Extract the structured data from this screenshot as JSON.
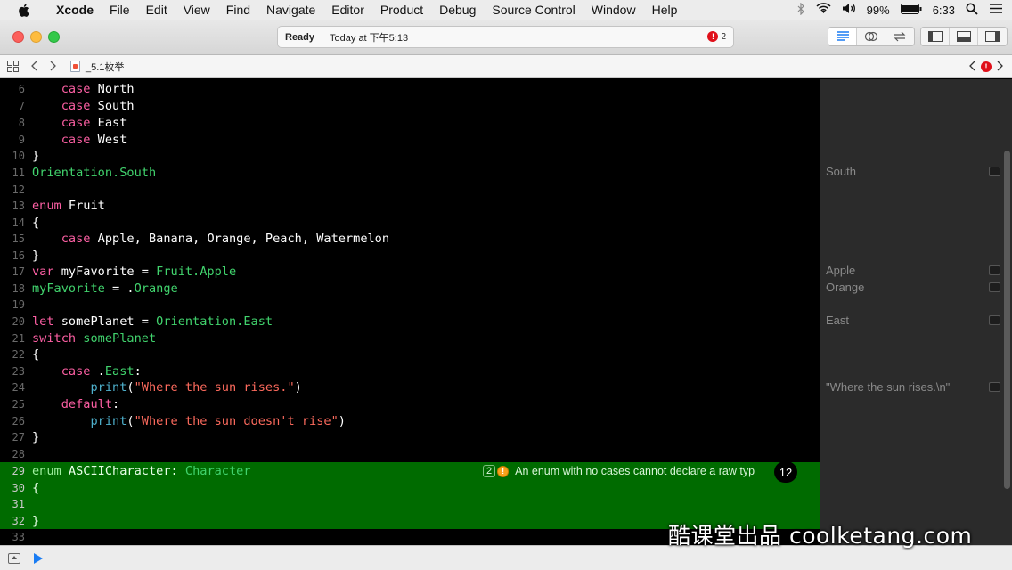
{
  "menubar": {
    "app_name": "Xcode",
    "items": [
      "File",
      "Edit",
      "View",
      "Find",
      "Navigate",
      "Editor",
      "Product",
      "Debug",
      "Source Control",
      "Window",
      "Help"
    ],
    "battery": "99%",
    "time": "6:33"
  },
  "toolbar": {
    "status": "Ready",
    "timestamp": "Today at 下午5:13",
    "error_count": "2"
  },
  "jumpbar": {
    "file_name": "_5.1枚举"
  },
  "editor": {
    "lines": [
      {
        "n": "6"
      },
      {
        "n": "7"
      },
      {
        "n": "8"
      },
      {
        "n": "9"
      },
      {
        "n": "10"
      },
      {
        "n": "11"
      },
      {
        "n": "12"
      },
      {
        "n": "13"
      },
      {
        "n": "14"
      },
      {
        "n": "15"
      },
      {
        "n": "16"
      },
      {
        "n": "17"
      },
      {
        "n": "18"
      },
      {
        "n": "19"
      },
      {
        "n": "20"
      },
      {
        "n": "21"
      },
      {
        "n": "22"
      },
      {
        "n": "23"
      },
      {
        "n": "24"
      },
      {
        "n": "25"
      },
      {
        "n": "26"
      },
      {
        "n": "27"
      },
      {
        "n": "28"
      },
      {
        "n": "29"
      },
      {
        "n": "30"
      },
      {
        "n": "31"
      },
      {
        "n": "32"
      },
      {
        "n": "33"
      }
    ],
    "code": {
      "l6": "case",
      "l6b": " North",
      "l7": "case",
      "l7b": " South",
      "l8": "case",
      "l8b": " East",
      "l9": "case",
      "l9b": " West",
      "l10": "}",
      "l11": "Orientation.South",
      "l13": "enum",
      "l13b": " Fruit",
      "l14": "{",
      "l15": "case",
      "l15b": " Apple, Banana, Orange, Peach, Watermelon",
      "l16": "}",
      "l17a": "var",
      "l17b": " myFavorite = ",
      "l17c": "Fruit.Apple",
      "l18a": "myFavorite",
      "l18b": " = .",
      "l18c": "Orange",
      "l20a": "let",
      "l20b": " somePlanet = ",
      "l20c": "Orientation.East",
      "l21a": "switch",
      "l21b": " somePlanet",
      "l22": "{",
      "l23a": "case",
      "l23b": " .",
      "l23c": "East",
      "l23d": ":",
      "l24a": "print",
      "l24b": "(",
      "l24c": "\"Where the sun rises.\"",
      "l24d": ")",
      "l25a": "default",
      "l25b": ":",
      "l26a": "print",
      "l26b": "(",
      "l26c": "\"Where the sun doesn't rise\"",
      "l26d": ")",
      "l27": "}",
      "l29a": "enum",
      "l29b": " ASCIICharacter: ",
      "l29c": "Character",
      "l30": "{",
      "l32": "}"
    },
    "error_banner": {
      "count": "2",
      "message": "An enum with no cases cannot declare a raw typ",
      "badge": "12"
    }
  },
  "results": [
    {
      "value": "South"
    },
    {
      "value": "Apple"
    },
    {
      "value": "Orange"
    },
    {
      "value": "East"
    },
    {
      "value": "\"Where the sun rises.\\n\""
    }
  ],
  "watermark": "酷课堂出品 coolketang.com"
}
